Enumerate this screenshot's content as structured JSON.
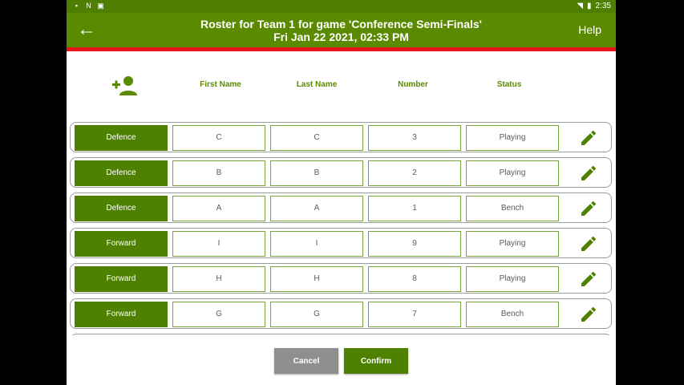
{
  "status_bar": {
    "time": "2:35",
    "icons_left": [
      "sd-card-icon",
      "n-icon",
      "download-icon"
    ],
    "icons_right": [
      "wifi-icon",
      "battery-icon"
    ]
  },
  "app_bar": {
    "title_line1": "Roster for Team 1 for game 'Conference Semi-Finals'",
    "title_line2": "Fri Jan 22 2021, 02:33 PM",
    "help_label": "Help"
  },
  "columns": {
    "first_name": "First Name",
    "last_name": "Last Name",
    "number": "Number",
    "status": "Status"
  },
  "rows": [
    {
      "position": "Defence",
      "first": "C",
      "last": "C",
      "number": "3",
      "status": "Playing"
    },
    {
      "position": "Defence",
      "first": "B",
      "last": "B",
      "number": "2",
      "status": "Playing"
    },
    {
      "position": "Defence",
      "first": "A",
      "last": "A",
      "number": "1",
      "status": "Bench"
    },
    {
      "position": "Forward",
      "first": "I",
      "last": "I",
      "number": "9",
      "status": "Playing"
    },
    {
      "position": "Forward",
      "first": "H",
      "last": "H",
      "number": "8",
      "status": "Playing"
    },
    {
      "position": "Forward",
      "first": "G",
      "last": "G",
      "number": "7",
      "status": "Bench"
    },
    {
      "position": "",
      "first": "",
      "last": "",
      "number": "",
      "status": ""
    }
  ],
  "footer": {
    "cancel_label": "Cancel",
    "confirm_label": "Confirm"
  },
  "colors": {
    "primary": "#5a8a00",
    "accent_line": "#e6141b",
    "cancel": "#8f8f8f"
  }
}
